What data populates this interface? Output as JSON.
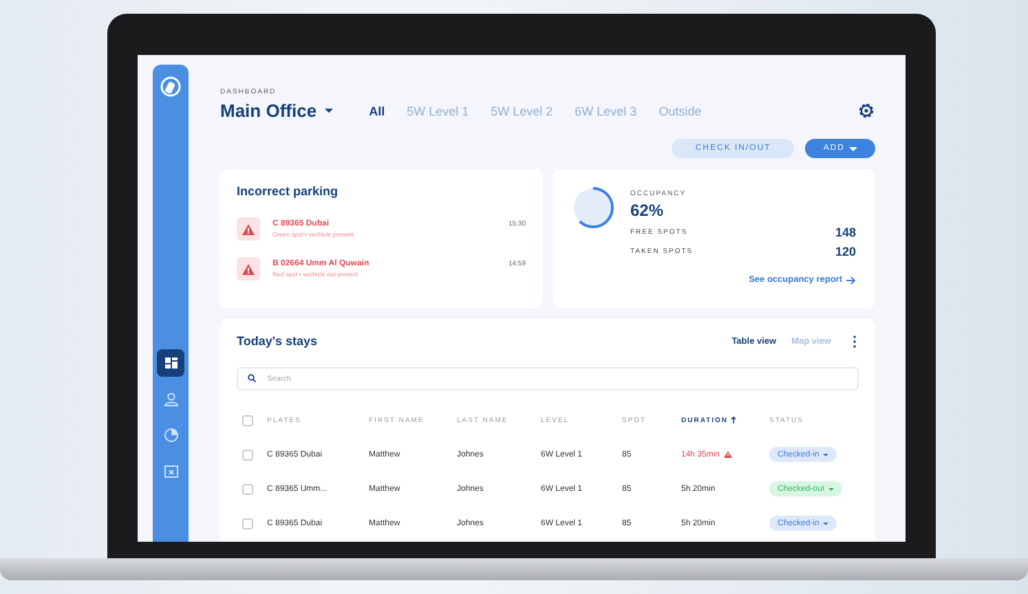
{
  "sidebar": {
    "items": [
      {
        "kind": "dashboard",
        "selected": true
      },
      {
        "kind": "person",
        "selected": false
      },
      {
        "kind": "chart",
        "selected": false
      },
      {
        "kind": "calendar",
        "selected": false
      }
    ]
  },
  "header": {
    "breadcrumb": "DASHBOARD",
    "title": "Main Office",
    "tabs": [
      {
        "label": "All",
        "selected": true
      },
      {
        "label": "5W Level 1",
        "selected": false
      },
      {
        "label": "5W Level 2",
        "selected": false
      },
      {
        "label": "6W Level 3",
        "selected": false
      },
      {
        "label": "Outside",
        "selected": false
      }
    ],
    "buttons": [
      {
        "label": "CHECK IN/OUT",
        "kind": "secondary"
      },
      {
        "label": "ADD",
        "kind": "primary"
      }
    ]
  },
  "incorrect_parking": {
    "title": "Incorrect parking",
    "items": [
      {
        "plate": "C 89365 Dubai",
        "note": "Green spot • vechicle present",
        "time": "15:30"
      },
      {
        "plate": "B 02664 Umm Al Quwain",
        "note": "Red spot • vechicle not present",
        "time": "14:59"
      }
    ]
  },
  "occupancy": {
    "label": "OCCUPANCY",
    "percent": "62%",
    "level": 0.62,
    "stats": [
      {
        "label": "FREE SPOTS",
        "value": "148"
      },
      {
        "label": "TAKEN SPOTS",
        "value": "120"
      }
    ],
    "link": "See occupancy report"
  },
  "stays": {
    "title": "Today's stays",
    "views": [
      {
        "label": "Table view",
        "selected": true
      },
      {
        "label": "Map view",
        "selected": false
      }
    ],
    "search": {
      "placeholder": "Search"
    },
    "select_all": {
      "checked": false
    },
    "columns": [
      {
        "label": "PLATES",
        "sorted": false
      },
      {
        "label": "FIRST NAME",
        "sorted": false
      },
      {
        "label": "LAST NAME",
        "sorted": false
      },
      {
        "label": "LEVEL",
        "sorted": false
      },
      {
        "label": "SPOT",
        "sorted": false
      },
      {
        "label": "DURATION",
        "sorted": true
      },
      {
        "label": "STATUS",
        "sorted": false
      }
    ],
    "rows": [
      {
        "checked": false,
        "plates": "C 89365 Dubai",
        "first_name": "Matthew",
        "last_name": "Johnes",
        "level": "6W Level 1",
        "spot": "85",
        "duration": "14h 35min",
        "overdue": true,
        "status": {
          "label": "Checked-in",
          "kind": "in"
        }
      },
      {
        "checked": false,
        "plates": "C 89365 Umm...",
        "first_name": "Matthew",
        "last_name": "Johnes",
        "level": "6W Level 1",
        "spot": "85",
        "duration": "5h 20min",
        "overdue": false,
        "status": {
          "label": "Checked-out",
          "kind": "out"
        }
      },
      {
        "checked": false,
        "plates": "C 89365 Dubai",
        "first_name": "Matthew",
        "last_name": "Johnes",
        "level": "6W Level 1",
        "spot": "85",
        "duration": "5h 20min",
        "overdue": false,
        "status": {
          "label": "Checked-in",
          "kind": "in"
        }
      }
    ]
  }
}
